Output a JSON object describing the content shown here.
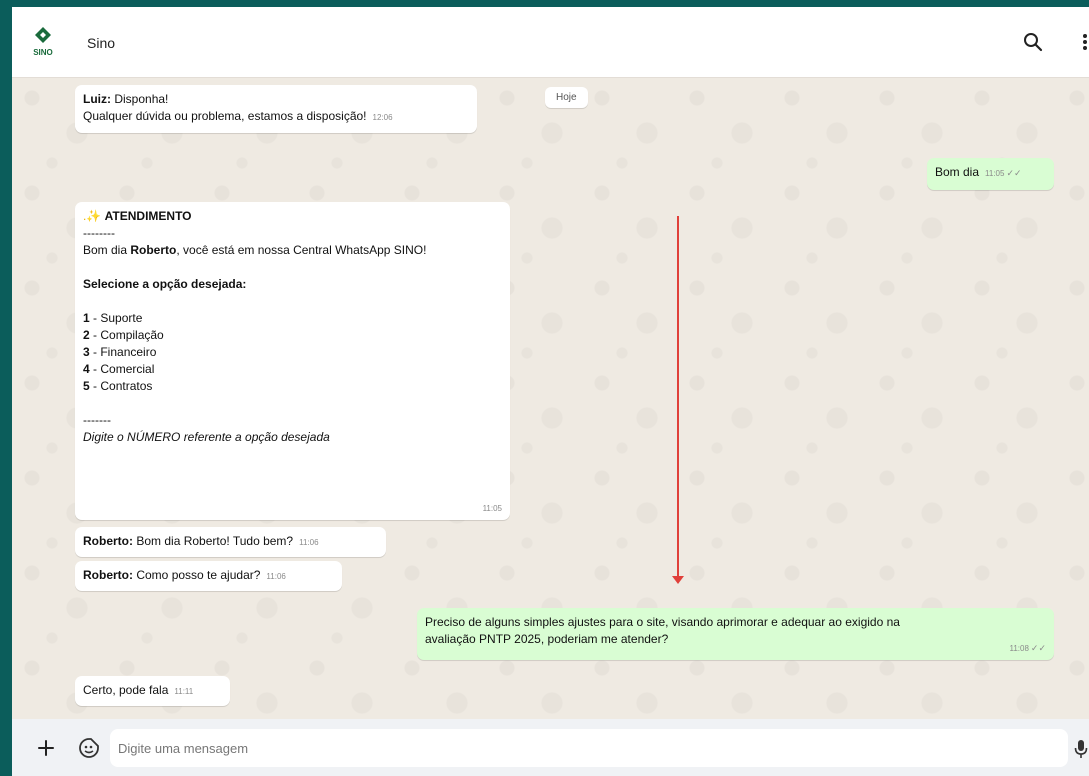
{
  "header": {
    "contact_name": "Sino",
    "logo_text": "SINO"
  },
  "date_chip": "Hoje",
  "messages": {
    "m1": {
      "sender": "Luiz:",
      "line1": "Disponha!",
      "line2": "Qualquer dúvida ou problema, estamos a disposição!",
      "time": "12:06"
    },
    "m2": {
      "text": "Bom dia",
      "time": "11:05"
    },
    "m3": {
      "title": "ATENDIMENTO",
      "divider1": "--------",
      "greeting_pre": "Bom dia ",
      "greeting_name": "Roberto",
      "greeting_post": ", você está em nossa Central WhatsApp SINO!",
      "prompt": "Selecione a opção desejada:",
      "options": [
        {
          "num": "1",
          "label": " - Suporte"
        },
        {
          "num": "2",
          "label": " - Compilação"
        },
        {
          "num": "3",
          "label": " - Financeiro"
        },
        {
          "num": "4",
          "label": " - Comercial"
        },
        {
          "num": "5",
          "label": " - Contratos"
        }
      ],
      "divider2": "-------",
      "instruction": "Digite o NÚMERO referente a opção desejada",
      "time": "11:05"
    },
    "m4": {
      "sender": "Roberto:",
      "text": "Bom dia Roberto! Tudo bem?",
      "time": "11:06"
    },
    "m5": {
      "sender": "Roberto:",
      "text": "Como posso te ajudar?",
      "time": "11:06"
    },
    "m6": {
      "line1": "Preciso de alguns simples ajustes para o site, visando aprimorar e adequar ao exigido na",
      "line2": "avaliação PNTP 2025, poderiam me atender?",
      "time": "11:08"
    },
    "m7": {
      "text": "Certo, pode fala",
      "time": "11:11"
    }
  },
  "composer": {
    "placeholder": "Digite uma mensagem"
  },
  "colors": {
    "header_bg": "#ffffff",
    "chat_bg": "#efeae2",
    "outgoing_bubble": "#d9fdd3",
    "incoming_bubble": "#ffffff",
    "annotation_arrow": "#e0403a",
    "frame_border": "#0b5d5b"
  },
  "icons": [
    "sino-logo",
    "search-icon",
    "menu-dots-icon",
    "plus-icon",
    "sticker-icon",
    "mic-icon",
    "double-check-icon",
    "sparkle-icon"
  ]
}
